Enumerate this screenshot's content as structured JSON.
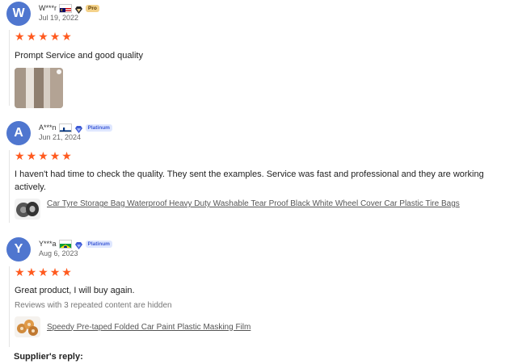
{
  "reviews": [
    {
      "avatar_letter": "W",
      "username": "W***r",
      "country_flag": "malaysia",
      "badge": "Pro",
      "date": "Jul 19, 2022",
      "rating": 5,
      "text": "Prompt Service and good quality",
      "has_photo": true
    },
    {
      "avatar_letter": "A",
      "username": "A***n",
      "country_flag": "finland",
      "badge": "Platinum",
      "date": "Jun 21, 2024",
      "rating": 5,
      "text": "I haven't had time to check the quality. They sent the examples. Service was fast and professional and they are working actively.",
      "product_link": "Car Tyre Storage Bag Waterproof Heavy Duty Washable Tear Proof Black White Wheel Cover Car Plastic Tire Bags"
    },
    {
      "avatar_letter": "Y",
      "username": "Y***a",
      "country_flag": "brazil",
      "badge": "Platinum",
      "date": "Aug 6, 2023",
      "rating": 5,
      "text": "Great product, I will buy again.",
      "hidden_note": "Reviews with 3 repeated content are hidden",
      "product_link": "Speedy Pre-taped Folded Car Paint Plastic Masking Film"
    }
  ],
  "supplier_reply_label": "Supplier's reply:",
  "colors": {
    "avatar": "#4f76cf",
    "star": "#ff5a1f",
    "platinum": "#3e5bd6"
  },
  "icons": [
    "star-icon",
    "diamond-badge-icon",
    "flag-icon"
  ]
}
